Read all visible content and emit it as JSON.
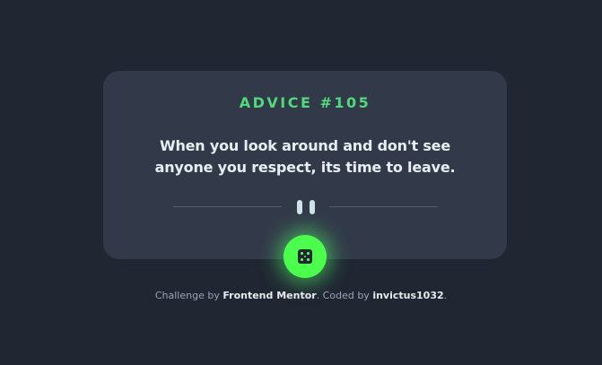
{
  "card": {
    "advice_label": "ADVICE #105",
    "quote": "When you look around and don't see anyone you respect, its time to leave."
  },
  "divider": {
    "icon": "pause-icon"
  },
  "dice_button": {
    "icon": "dice-icon"
  },
  "footer": {
    "prefix": "Challenge by ",
    "challenge_link": "Frontend Mentor",
    "middle": ". Coded by ",
    "author_link": "invictus1032",
    "suffix": "."
  },
  "colors": {
    "background": "#202632",
    "card": "#323a49",
    "accent_green": "#52d97e",
    "button_green": "#4cff4c",
    "quote_text": "#e7eef2",
    "divider": "#4f5d74"
  }
}
